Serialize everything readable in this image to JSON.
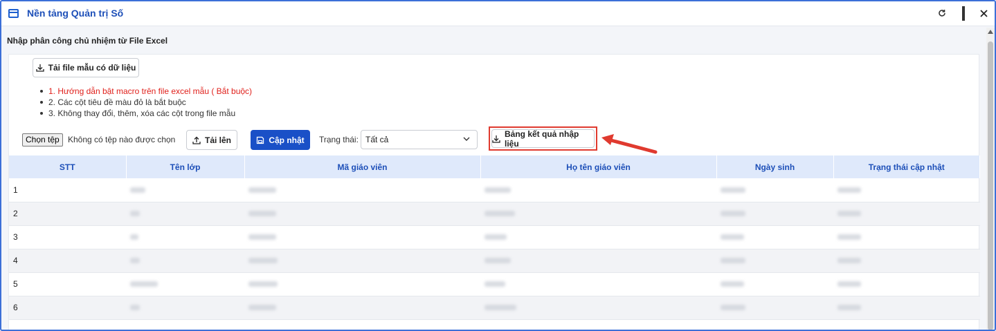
{
  "window": {
    "title": "Nền tảng Quản trị Số"
  },
  "section_title": "Nhập phân công chủ nhiệm từ File Excel",
  "download_template": {
    "label": "Tải file mẫu có dữ liệu"
  },
  "notes": [
    "1. Hướng dẫn bật macro trên file excel mẫu ( Bắt buộc)",
    "2. Các cột tiêu đề màu đỏ là bắt buộc",
    "3. Không thay đổi, thêm, xóa các cột trong file mẫu"
  ],
  "file_input": {
    "button": "Chọn tệp",
    "status": "Không có tệp nào được chọn"
  },
  "upload_button": "Tải lên",
  "update_button": "Cập nhật",
  "status_filter": {
    "label": "Trạng thái:",
    "value": "Tất cả"
  },
  "result_button": "Bảng kết quả nhập liệu",
  "table": {
    "headers": [
      "STT",
      "Tên lớp",
      "Mã giáo viên",
      "Họ tên giáo viên",
      "Ngày sinh",
      "Trạng thái cập nhật"
    ],
    "rows": [
      "1",
      "2",
      "3",
      "4",
      "5",
      "6"
    ]
  },
  "colors": {
    "accent": "#1a50c7",
    "highlight": "#e03a2f",
    "header_bg": "#dfe9fb"
  }
}
